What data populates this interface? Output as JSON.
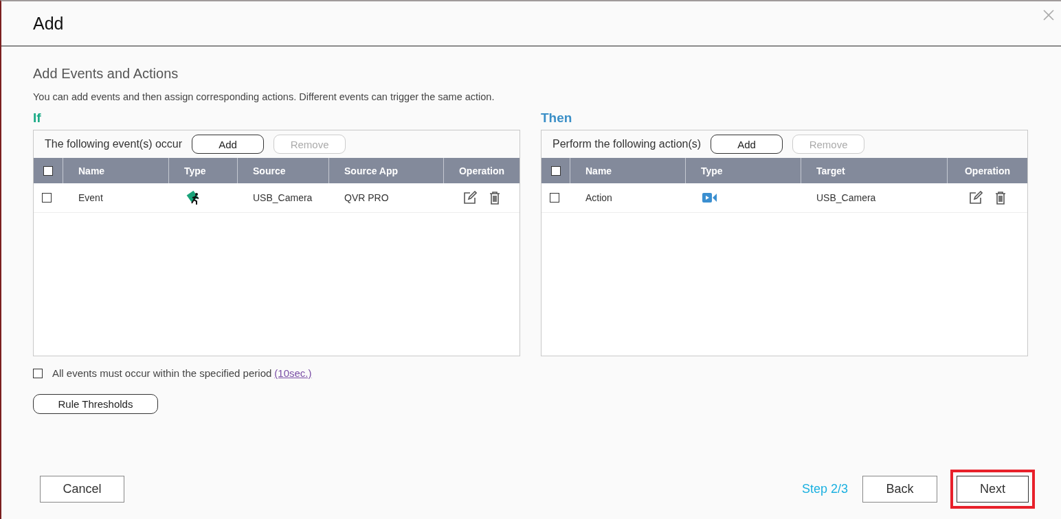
{
  "dialog": {
    "title": "Add"
  },
  "section": {
    "title": "Add Events and Actions",
    "description": "You can add events and then assign corresponding actions. Different events can trigger the same action."
  },
  "panels": [
    {
      "kind": "if",
      "heading": "If",
      "caption": "The following event(s) occur",
      "buttons": [
        {
          "label": "Add",
          "disabled": false
        },
        {
          "label": "Remove",
          "disabled": true
        }
      ],
      "all_checked": false,
      "columns": [
        {
          "label": "Name",
          "kind": "text"
        },
        {
          "label": "Type",
          "kind": "icon"
        },
        {
          "label": "Source",
          "kind": "text"
        },
        {
          "label": "Source App",
          "kind": "text"
        },
        {
          "label": "Operation",
          "kind": "operation"
        }
      ],
      "rows": [
        {
          "checked": false,
          "cells": [
            "Event",
            "",
            "USB_Camera",
            "QVR PRO",
            ""
          ]
        }
      ]
    },
    {
      "kind": "then",
      "heading": "Then",
      "caption": "Perform the following action(s)",
      "buttons": [
        {
          "label": "Add",
          "disabled": false
        },
        {
          "label": "Remove",
          "disabled": true
        }
      ],
      "all_checked": false,
      "columns": [
        {
          "label": "Name",
          "kind": "text"
        },
        {
          "label": "Type",
          "kind": "icon"
        },
        {
          "label": "Target",
          "kind": "text"
        },
        {
          "label": "Operation",
          "kind": "operation"
        }
      ],
      "rows": [
        {
          "checked": false,
          "cells": [
            "Action",
            "",
            "USB_Camera",
            ""
          ]
        }
      ]
    }
  ],
  "period": {
    "checked": false,
    "text": "All events must occur within the specified period",
    "link": "(10sec.)"
  },
  "rule_button": "Rule Thresholds",
  "footer": {
    "cancel": "Cancel",
    "step": "Step 2/3",
    "buttons": [
      {
        "label": "Back",
        "highlighted": false
      },
      {
        "label": "Next",
        "highlighted": true
      }
    ]
  }
}
